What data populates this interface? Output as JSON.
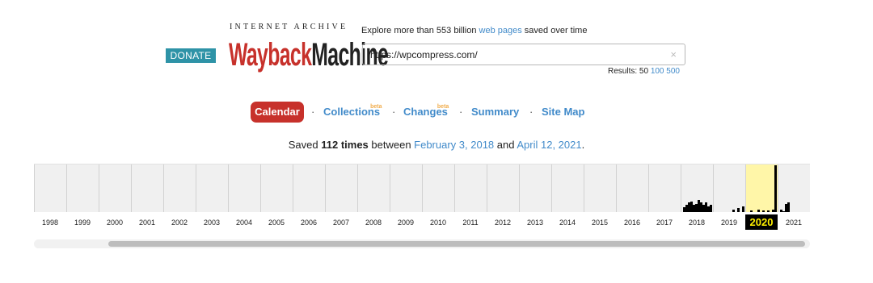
{
  "header": {
    "donate_label": "DONATE",
    "logo_top_text": "INTERNET ARCHIVE",
    "logo_wayback": "Wayback",
    "logo_machine": "Machine",
    "explore_prefix": "Explore more than 553 billion ",
    "explore_link": "web pages",
    "explore_suffix": " saved over time",
    "url_value": "https://wpcompress.com/",
    "clear_icon": "×",
    "results_label": "Results: 50 ",
    "results_100": "100",
    "results_500": "500"
  },
  "nav": {
    "tabs": [
      {
        "label": "Calendar",
        "active": true
      },
      {
        "label": "Collections",
        "badge": "beta"
      },
      {
        "label": "Changes",
        "badge": "beta"
      },
      {
        "label": "Summary"
      },
      {
        "label": "Site Map"
      }
    ],
    "separator": "·"
  },
  "summary": {
    "prefix": "Saved ",
    "count": "112 times",
    "between": " between ",
    "first_date": "February 3, 2018",
    "and": " and ",
    "last_date": "April 12, 2021",
    "suffix": "."
  },
  "timeline": {
    "years": [
      "1998",
      "1999",
      "2000",
      "2001",
      "2002",
      "2003",
      "2004",
      "2005",
      "2006",
      "2007",
      "2008",
      "2009",
      "2010",
      "2011",
      "2012",
      "2013",
      "2014",
      "2015",
      "2016",
      "2017",
      "2018",
      "2019",
      "2020",
      "2021"
    ],
    "selected_year": "2020",
    "highlight_color": "#fff6a8",
    "capture_levels": {
      "2018": [
        0.1,
        0.16,
        0.2,
        0.22,
        0.15,
        0.18,
        0.25,
        0.2,
        0.15,
        0.2,
        0.12,
        0.16
      ],
      "2019": [
        0,
        0,
        0,
        0,
        0,
        0,
        0,
        0.05,
        0,
        0.08,
        0,
        0.12
      ],
      "2020": [
        0,
        0.04,
        0,
        0,
        0.05,
        0,
        0.04,
        0,
        0.03,
        0,
        0.05,
        1.0
      ],
      "2021": [
        0.05,
        0.02,
        0.18,
        0.2,
        0,
        0,
        0,
        0,
        0,
        0,
        0,
        0
      ]
    }
  }
}
